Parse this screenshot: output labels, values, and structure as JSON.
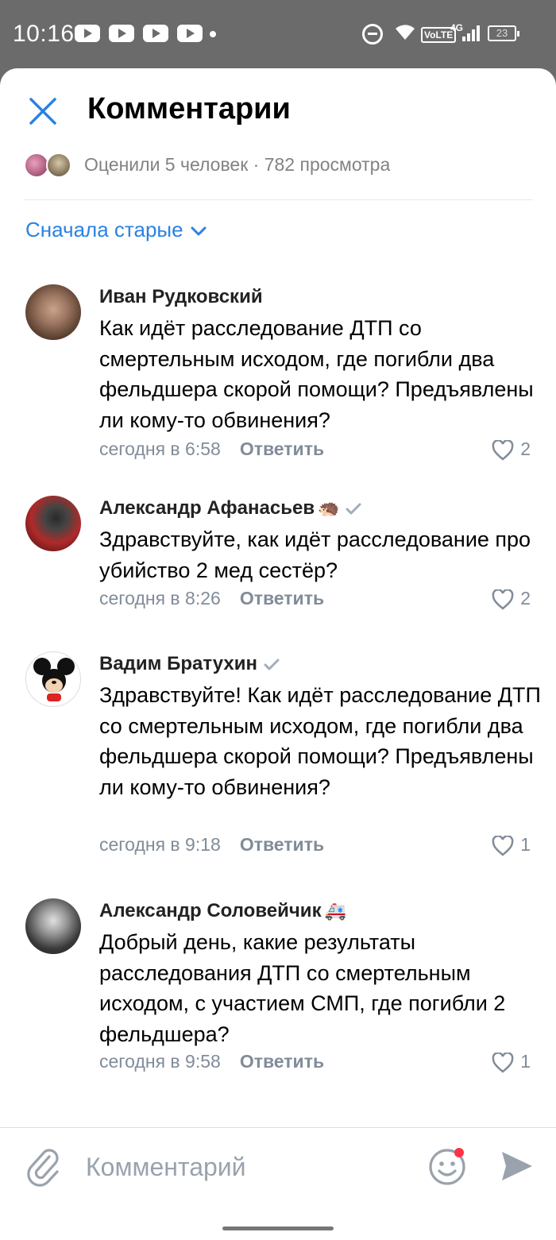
{
  "status_bar": {
    "time": "10:16",
    "network": "VoLTE",
    "network_type": "4G",
    "battery": "23"
  },
  "header": {
    "title": "Комментарии",
    "close_icon": "close-icon"
  },
  "likes_summary": {
    "text": "Оценили 5 человек · 782 просмотра"
  },
  "sort": {
    "label": "Сначала старые"
  },
  "comments": [
    {
      "author": "Иван Рудковский",
      "emoji": "",
      "verified": false,
      "text": "Как идёт расследование ДТП со смертельным исходом, где погибли два фельдшера скорой помощи? Предъявлены ли кому-то обвинения?",
      "time": "сегодня в 6:58",
      "reply_label": "Ответить",
      "likes": "2"
    },
    {
      "author": "Александр Афанасьев",
      "emoji": "🦔",
      "verified": true,
      "text": "Здравствуйте, как идёт расследование про убийство 2 мед сестёр?",
      "time": "сегодня в 8:26",
      "reply_label": "Ответить",
      "likes": "2"
    },
    {
      "author": "Вадим Братухин",
      "emoji": "",
      "verified": true,
      "text": "Здравствуйте! Как идёт расследование ДТП со смертельным исходом, где погибли два фельдшера скорой помощи? Предъявлены ли кому-то обвинения?",
      "time": "сегодня в 9:18",
      "reply_label": "Ответить",
      "likes": "1"
    },
    {
      "author": "Александр Соловейчик",
      "emoji": "🚑",
      "verified": false,
      "text": "Добрый день, какие результаты расследования ДТП со смертельным исходом, с участием СМП, где погибли 2 фельдшера?",
      "time": "сегодня в 9:58",
      "reply_label": "Ответить",
      "likes": "1"
    }
  ],
  "input": {
    "placeholder": "Комментарий"
  },
  "colors": {
    "accent": "#2a82e4",
    "secondary_text": "#818c99",
    "icon_gray": "#99a2ad"
  }
}
